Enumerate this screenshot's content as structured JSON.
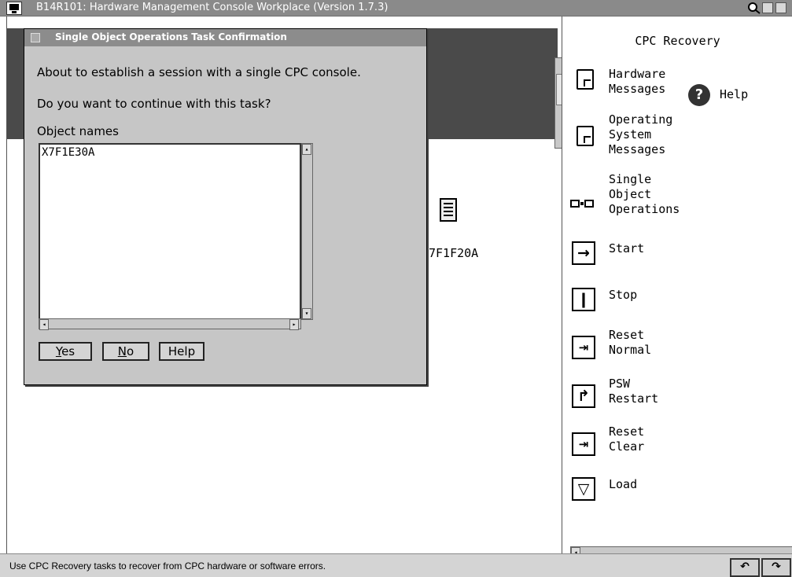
{
  "window": {
    "title": "B14R101: Hardware Management Console Workplace (Version 1.7.3)"
  },
  "workarea": {
    "objects": [
      {
        "label": "7F1F20A",
        "icon": "cpc-computer-icon"
      }
    ]
  },
  "panel": {
    "title": "CPC Recovery",
    "help_label": "Help",
    "tasks": [
      {
        "label": "Hardware\nMessages",
        "icon": "document-icon"
      },
      {
        "label": "Operating\nSystem\nMessages",
        "icon": "document-icon"
      },
      {
        "label": "Single\nObject\nOperations",
        "icon": "two-computers-icon"
      },
      {
        "label": "Start",
        "icon": "arrow-right-icon"
      },
      {
        "label": "Stop",
        "icon": "stop-bar-icon"
      },
      {
        "label": "Reset\nNormal",
        "icon": "reset-arrow-icon"
      },
      {
        "label": "PSW\nRestart",
        "icon": "psw-restart-icon"
      },
      {
        "label": "Reset\nClear",
        "icon": "reset-arrow-icon"
      },
      {
        "label": "Load",
        "icon": "load-down-icon"
      }
    ]
  },
  "dialog": {
    "title": "Single Object Operations Task Confirmation",
    "message1": "About to establish a session with a single CPC console.",
    "message2": "Do you want to continue with this task?",
    "list_label": "Object names",
    "objects": [
      "X7F1E30A"
    ],
    "buttons": {
      "yes": "es",
      "yes_mnemonic": "Y",
      "no": "o",
      "no_mnemonic": "N",
      "help": "Help"
    }
  },
  "statusbar": {
    "message": "Use CPC Recovery tasks to recover from CPC hardware or software errors."
  }
}
